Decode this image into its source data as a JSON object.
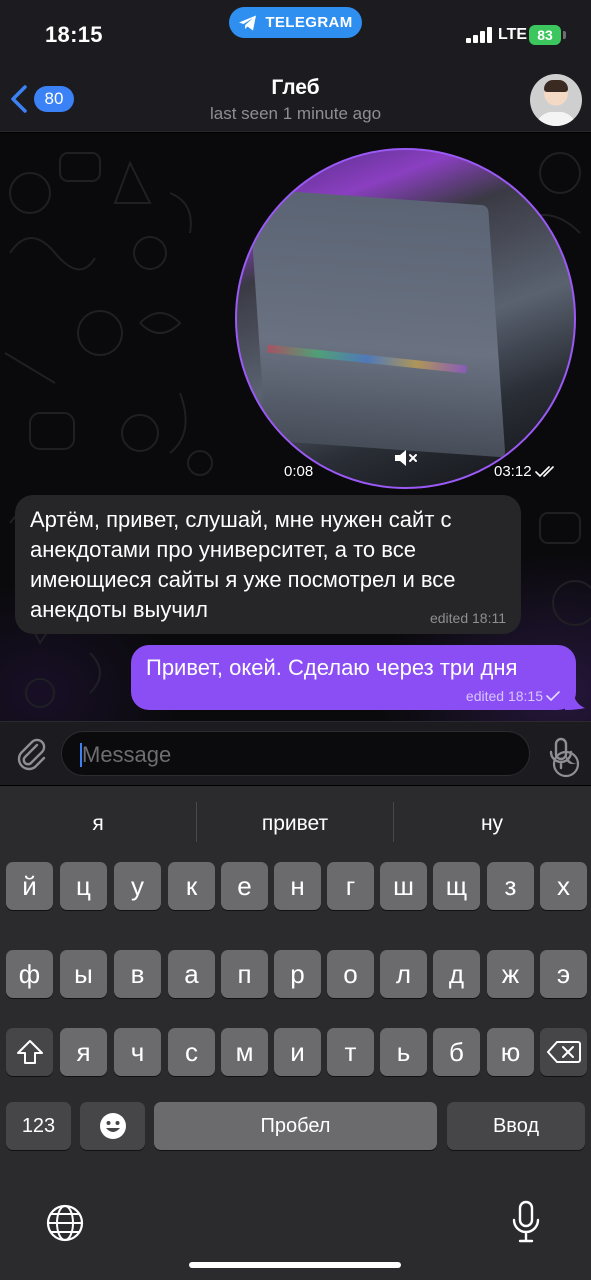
{
  "status_bar": {
    "time": "18:15",
    "app_pill": "TELEGRAM",
    "network": "LTE",
    "battery": "83"
  },
  "header": {
    "back_count": "80",
    "title": "Глеб",
    "subtitle": "last seen 1 minute ago"
  },
  "video_message": {
    "duration": "0:08",
    "time": "03:12",
    "muted": true,
    "status": "read"
  },
  "messages": [
    {
      "direction": "incoming",
      "text": "Артём, привет, слушай, мне нужен сайт с анекдотами про университет, а то все имеющиеся сайты я уже посмотрел и все анекдоты выучил",
      "meta": "edited 18:11"
    },
    {
      "direction": "outgoing",
      "text": "Привет, окей. Сделаю через три дня",
      "meta": "edited 18:15",
      "status": "sent"
    }
  ],
  "composer": {
    "placeholder": "Message"
  },
  "keyboard": {
    "suggestions": [
      "я",
      "привет",
      "ну"
    ],
    "row1": [
      "й",
      "ц",
      "у",
      "к",
      "е",
      "н",
      "г",
      "ш",
      "щ",
      "з",
      "х"
    ],
    "row2": [
      "ф",
      "ы",
      "в",
      "а",
      "п",
      "р",
      "о",
      "л",
      "д",
      "ж",
      "э"
    ],
    "row3": [
      "я",
      "ч",
      "с",
      "м",
      "и",
      "т",
      "ь",
      "б",
      "ю"
    ],
    "numbers_key": "123",
    "space_key": "Пробел",
    "return_key": "Ввод"
  },
  "colors": {
    "accent": "#3b82f6",
    "outgoing_bubble": "#8b4ef5",
    "incoming_bubble": "#262528",
    "battery": "#3bc75e"
  },
  "icons": [
    "telegram-icon",
    "signal-icon",
    "back-chevron-icon",
    "mute-icon",
    "double-check-icon",
    "check-icon",
    "paperclip-icon",
    "sticker-icon",
    "microphone-icon",
    "shift-icon",
    "backspace-icon",
    "emoji-icon",
    "globe-icon",
    "dictation-icon"
  ]
}
